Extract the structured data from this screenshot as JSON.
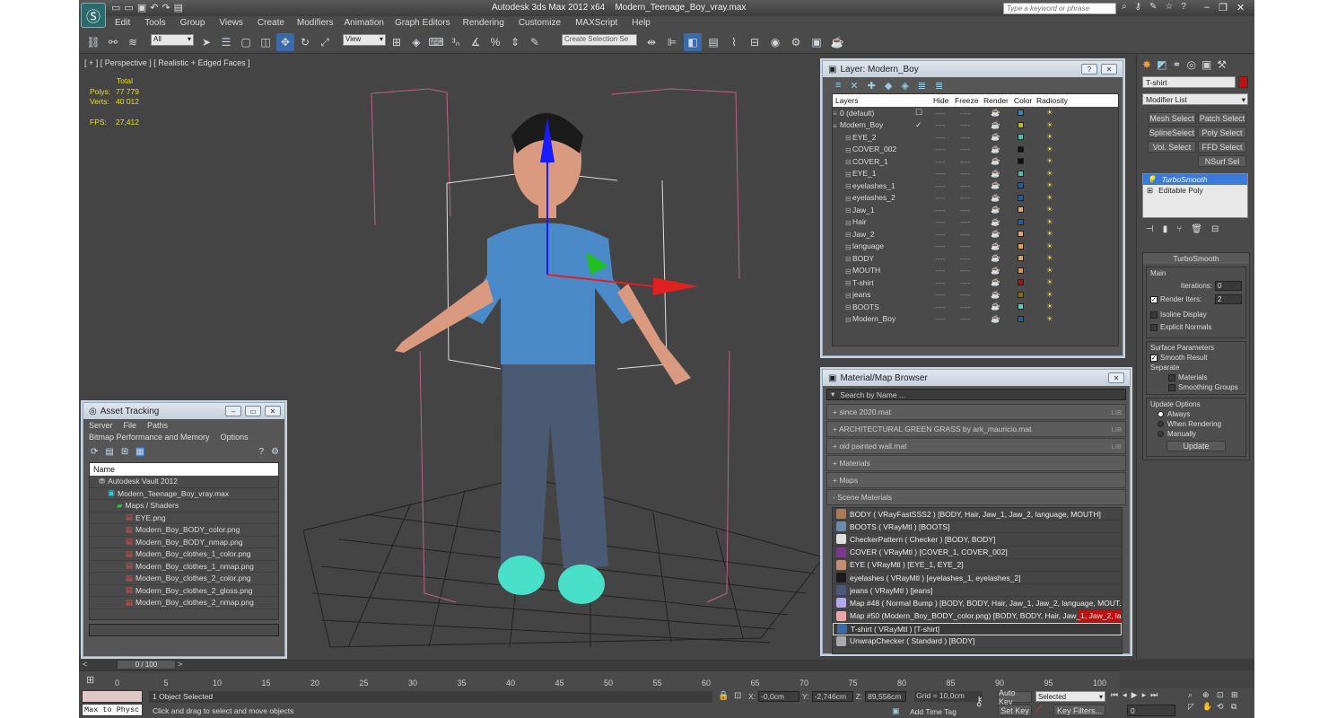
{
  "titlebar": {
    "app": "Autodesk 3ds Max  2012 x64",
    "file": "Modern_Teenage_Boy_vray.max",
    "search_placeholder": "Type a keyword or phrase"
  },
  "menu": [
    "Edit",
    "Tools",
    "Group",
    "Views",
    "Create",
    "Modifiers",
    "Animation",
    "Graph Editors",
    "Rendering",
    "Customize",
    "MAXScript",
    "Help"
  ],
  "toolbar": {
    "filter": "All",
    "refcoord": "View",
    "selset": "Create Selection Se"
  },
  "viewport": {
    "label": "[ + ] [ Perspective ] [ Realistic + Edged Faces ]",
    "stats_header": "Total",
    "polys_label": "Polys:",
    "polys": "77 779",
    "verts_label": "Verts:",
    "verts": "40 012",
    "fps_label": "FPS:",
    "fps": "27,412"
  },
  "layer": {
    "title": "Layer: Modern_Boy",
    "cols": [
      "Layers",
      "Hide",
      "Freeze",
      "Render",
      "Color",
      "Radiosity"
    ],
    "rows": [
      {
        "name": "0 (default)",
        "color": "#1e8fd8",
        "indent": 0,
        "check": "☐"
      },
      {
        "name": "Modern_Boy",
        "color": "#c8b800",
        "indent": 0,
        "check": "✓"
      },
      {
        "name": "EYE_2",
        "color": "#38c8b0",
        "indent": 1
      },
      {
        "name": "COVER_002",
        "color": "#101010",
        "indent": 1
      },
      {
        "name": "COVER_1",
        "color": "#101010",
        "indent": 1
      },
      {
        "name": "EYE_1",
        "color": "#38c8b0",
        "indent": 1
      },
      {
        "name": "eyelashes_1",
        "color": "#1e5fa8",
        "indent": 1
      },
      {
        "name": "eyelashes_2",
        "color": "#1e5fa8",
        "indent": 1
      },
      {
        "name": "Jaw_1",
        "color": "#e8a070",
        "indent": 1
      },
      {
        "name": "Hair",
        "color": "#1e5fa8",
        "indent": 1
      },
      {
        "name": "Jaw_2",
        "color": "#e8a070",
        "indent": 1
      },
      {
        "name": "language",
        "color": "#e8a040",
        "indent": 1
      },
      {
        "name": "BODY",
        "color": "#e8a040",
        "indent": 1
      },
      {
        "name": "MOUTH",
        "color": "#e89030",
        "indent": 1
      },
      {
        "name": "T-shirt",
        "color": "#a81010",
        "indent": 1
      },
      {
        "name": "jeans",
        "color": "#8a6a10",
        "indent": 1
      },
      {
        "name": "BOOTS",
        "color": "#30e0c0",
        "indent": 1
      },
      {
        "name": "Modern_Boy",
        "color": "#1e5fa8",
        "indent": 1
      }
    ]
  },
  "matbrowser": {
    "title": "Material/Map Browser",
    "search": "Search by Name ...",
    "rollouts": [
      {
        "label": "+ since 2020.mat",
        "tag": "LIB"
      },
      {
        "label": "+ ARCHITECTURAL GREEN GRASS by ark_mauricio.mat",
        "tag": "LIB"
      },
      {
        "label": "+ old painted wall.mat",
        "tag": "LIB"
      },
      {
        "label": "+ Materials",
        "tag": ""
      },
      {
        "label": "+ Maps",
        "tag": ""
      },
      {
        "label": "- Scene Materials",
        "tag": ""
      }
    ],
    "items": [
      {
        "text": "BODY  ( VRayFastSSS2 ) [BODY, Hair, Jaw_1, Jaw_2, language, MOUTH]",
        "color": "#a87a5a"
      },
      {
        "text": "BOOTS ( VRayMtl ) [BOOTS]",
        "color": "#6a8aaa"
      },
      {
        "text": "CheckerPattern  ( Checker ) [BODY, BODY]",
        "color": "#e0e0e0"
      },
      {
        "text": "COVER  ( VRayMtl ) [COVER_1, COVER_002]",
        "color": "#7a3a8a"
      },
      {
        "text": "EYE  ( VRayMtl ) [EYE_1, EYE_2]",
        "color": "#c09070"
      },
      {
        "text": "eyelashes  ( VRayMtl ) [eyelashes_1, eyelashes_2]",
        "color": "#1a1a1a"
      },
      {
        "text": "jeans  ( VRayMtl ) [jeans]",
        "color": "#4a5a7a"
      },
      {
        "text": "Map #48  ( Normal Bump ) [BODY, BODY, Hair, Jaw_1, Jaw_2, language, MOUT...",
        "color": "#b0a8e8"
      },
      {
        "text": "Map #50 (Modern_Boy_BODY_color.png)  [BODY, BODY, Hair, Jaw_1, Jaw_2, la...",
        "color": "#e8a8a8"
      },
      {
        "text": "T-shirt  ( VRayMtl ) [T-shirt]",
        "color": "#3a6aaa"
      },
      {
        "text": "UnwrapChecker  ( Standard ) [BODY]",
        "color": "#aaaaaa"
      }
    ]
  },
  "asset": {
    "title": "Asset Tracking",
    "menu1": [
      "Server",
      "File",
      "Paths"
    ],
    "menu2": [
      "Bitmap Performance and Memory",
      "Options"
    ],
    "col": "Name",
    "items": [
      {
        "text": "Autodesk Vault 2012",
        "indent": 1
      },
      {
        "text": "Modern_Teenage_Boy_vray.max",
        "indent": 2
      },
      {
        "text": "Maps / Shaders",
        "indent": 3
      },
      {
        "text": "EYE.png",
        "indent": 4
      },
      {
        "text": "Modern_Boy_BODY_color.png",
        "indent": 4
      },
      {
        "text": "Modern_Boy_BODY_nmap.png",
        "indent": 4
      },
      {
        "text": "Modern_Boy_clothes_1_color.png",
        "indent": 4
      },
      {
        "text": "Modern_Boy_clothes_1_nmap.png",
        "indent": 4
      },
      {
        "text": "Modern_Boy_clothes_2_color.png",
        "indent": 4
      },
      {
        "text": "Modern_Boy_clothes_2_gloss.png",
        "indent": 4
      },
      {
        "text": "Modern_Boy_clothes_2_nmap.png",
        "indent": 4
      }
    ]
  },
  "cmdpanel": {
    "object": "T-shirt",
    "modlist": "Modifier List",
    "mods": [
      "Mesh Select",
      "Patch Select",
      "SplineSelect",
      "Poly Select",
      "Vol. Select",
      "FFD Select",
      "",
      "NSurf Sel"
    ],
    "stack": [
      "TurboSmooth",
      "Editable Poly"
    ],
    "ts": {
      "title": "TurboSmooth",
      "main": "Main",
      "iter_label": "Iterations:",
      "iter": "0",
      "render_label": "Render Iters:",
      "render": "2",
      "isoline": "Isoline Display",
      "explicit": "Explicit Normals",
      "surf": "Surface Parameters",
      "smooth": "Smooth Result",
      "separate": "Separate",
      "materials": "Materials",
      "groups": "Smoothing Groups",
      "update": "Update Options",
      "always": "Always",
      "whenrender": "When Rendering",
      "manually": "Manually",
      "update_btn": "Update"
    }
  },
  "timeline": {
    "frame": "0 / 100",
    "ticks": [
      "0",
      "5",
      "10",
      "15",
      "20",
      "25",
      "30",
      "35",
      "40",
      "45",
      "50",
      "55",
      "60",
      "65",
      "70",
      "75",
      "80",
      "85",
      "90",
      "95",
      "100"
    ]
  },
  "status": {
    "script": "Max to Physc",
    "selected": "1 Object Selected",
    "prompt": "Click and drag to select and move objects",
    "x_label": "X:",
    "x": "-0,0cm",
    "y_label": "Y:",
    "y": "-2,746cm",
    "z_label": "Z:",
    "z": "89,556cm",
    "grid": "Grid = 10,0cm",
    "addtag": "Add Time Tag",
    "autokey": "Auto Key",
    "setkey": "Set Key",
    "keymode": "Selected",
    "keyfilters": "Key Filters...",
    "frame": "0"
  }
}
